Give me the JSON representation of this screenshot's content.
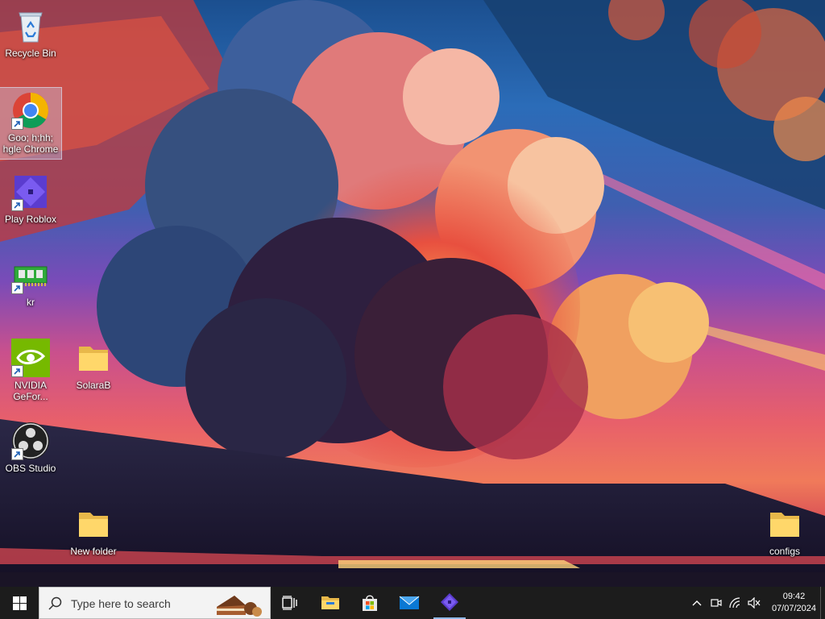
{
  "desktop": {
    "icons": [
      {
        "label": "Recycle Bin",
        "icon": "recycle-bin-icon"
      },
      {
        "label": "Goo; h;hh; hgle Chrome",
        "icon": "chrome-icon"
      },
      {
        "label": "Play Roblox",
        "icon": "roblox-icon"
      },
      {
        "label": "kr",
        "icon": "ram-chip-icon"
      },
      {
        "label": "NVIDIA GeFor...",
        "icon": "nvidia-icon"
      },
      {
        "label": "SolaraB",
        "icon": "folder-icon"
      },
      {
        "label": "OBS Studio",
        "icon": "obs-icon"
      },
      {
        "label": "New folder",
        "icon": "folder-icon"
      },
      {
        "label": "configs",
        "icon": "folder-icon"
      }
    ]
  },
  "taskbar": {
    "search_placeholder": "Type here to search",
    "pinned": [
      "task-view-icon",
      "file-explorer-icon",
      "microsoft-store-icon",
      "mail-icon",
      "roblox-icon"
    ],
    "tray": {
      "time": "09:42",
      "date": "07/07/2024"
    }
  },
  "colors": {
    "taskbar_bg": "#1c1c1c",
    "accent": "#0078d4"
  }
}
